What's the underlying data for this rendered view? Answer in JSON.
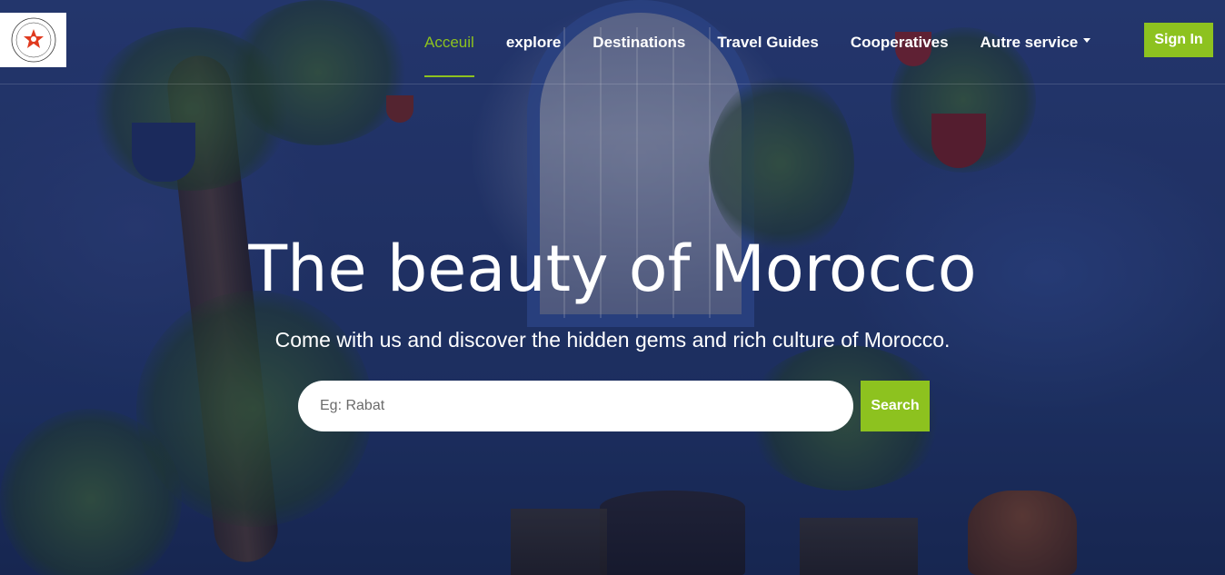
{
  "logo": {
    "alt_lines": [
      "MOROCCAN TREASURES",
      "MOROCCAN TREASURES"
    ],
    "color": "#e03a1f"
  },
  "nav": {
    "items": [
      {
        "label": "Acceuil",
        "active": true
      },
      {
        "label": "explore",
        "active": false
      },
      {
        "label": "Destinations",
        "active": false
      },
      {
        "label": "Travel Guides",
        "active": false
      },
      {
        "label": "Cooperatives",
        "active": false
      },
      {
        "label": "Autre service",
        "active": false,
        "dropdown": true
      }
    ],
    "signin_label": "Sign In"
  },
  "hero": {
    "title": "The beauty of Morocco",
    "subtitle": "Come with us and discover the hidden gems and rich culture of Morocco."
  },
  "search": {
    "placeholder": "Eg: Rabat",
    "value": "",
    "button_label": "Search"
  },
  "colors": {
    "accent": "#8dc21f",
    "text_light": "#ffffff"
  }
}
